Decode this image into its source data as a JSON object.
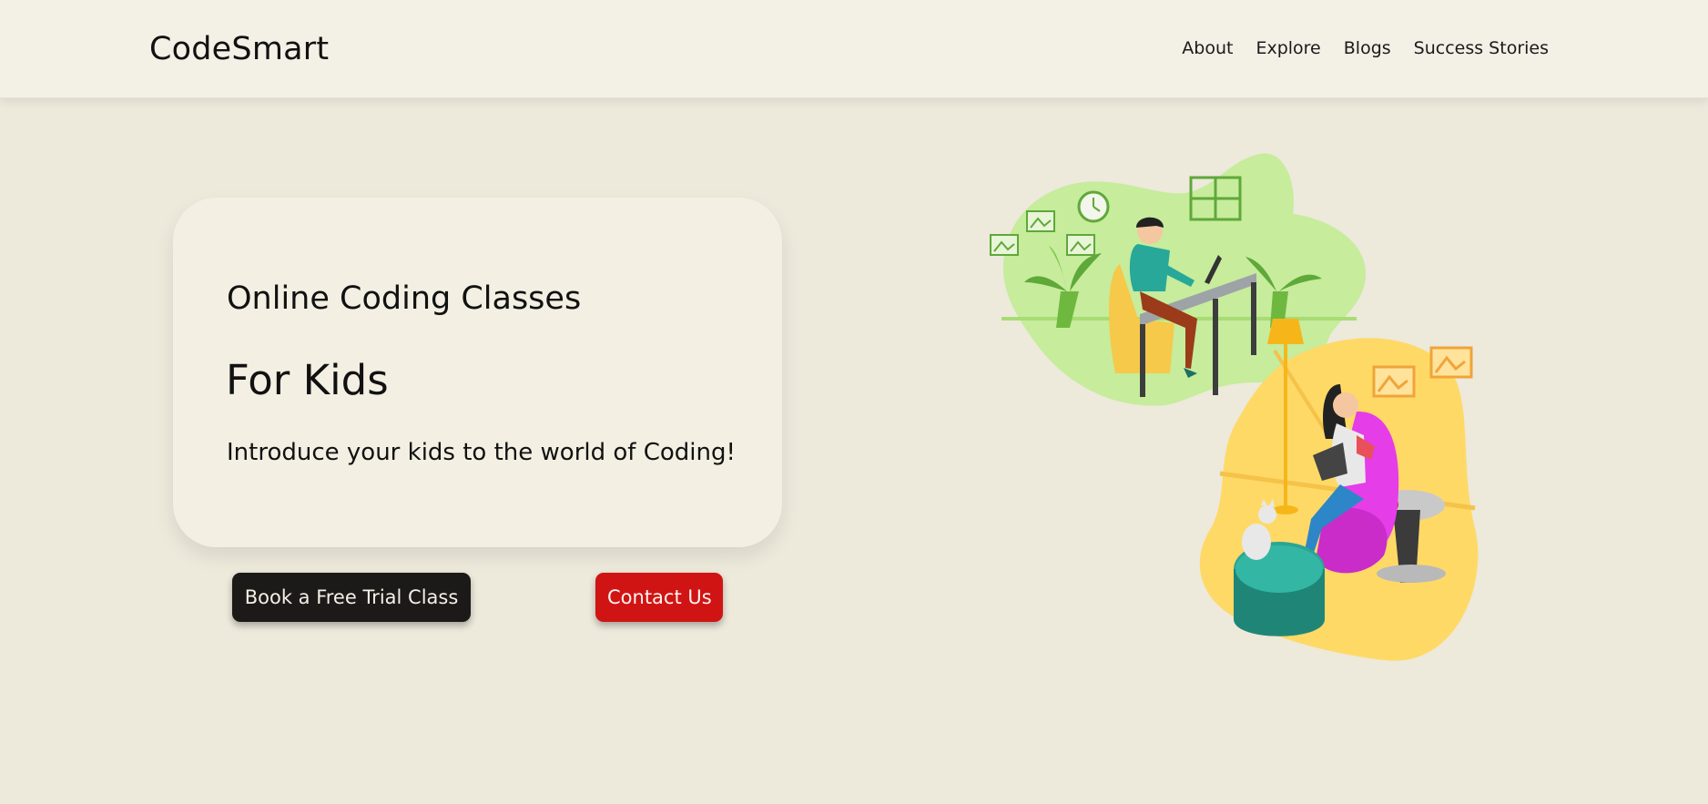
{
  "header": {
    "brand": "CodeSmart",
    "nav": [
      {
        "label": "About"
      },
      {
        "label": "Explore"
      },
      {
        "label": "Blogs"
      },
      {
        "label": "Success Stories"
      }
    ]
  },
  "hero": {
    "title": "Online Coding Classes",
    "subtitle": "For Kids",
    "description": "Introduce your kids to the world of Coding!"
  },
  "actions": {
    "trial_label": "Book a Free Trial Class",
    "contact_label": "Contact Us"
  },
  "colors": {
    "background": "#ede9db",
    "navbar": "#f3f0e6",
    "card": "#f3efe2",
    "primary_button": "#1c1a19",
    "accent_button": "#d01414",
    "green_blob": "#c6ec9c",
    "yellow_blob": "#ffd966"
  },
  "icons": {
    "illustration": "kids-coding-illustration"
  }
}
